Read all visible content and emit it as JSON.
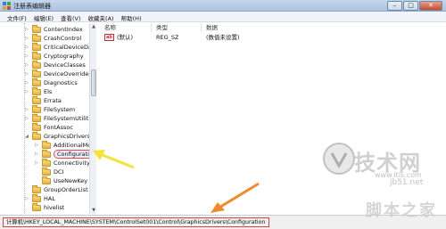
{
  "window": {
    "title": "注册表编辑器",
    "minimize_glyph": "–",
    "maximize_glyph": "□",
    "close_glyph": "✕"
  },
  "menu": [
    "文件(F)",
    "编辑(E)",
    "查看(V)",
    "收藏夹(A)",
    "帮助(H)"
  ],
  "tree": {
    "nodes": [
      {
        "label": "ContentIndex",
        "expander": "▷"
      },
      {
        "label": "CrashControl",
        "expander": "▷"
      },
      {
        "label": "CriticalDeviceDatab",
        "expander": "▷"
      },
      {
        "label": "Cryptography",
        "expander": "▷"
      },
      {
        "label": "DeviceClasses",
        "expander": "▷"
      },
      {
        "label": "DeviceOverrides",
        "expander": "▷"
      },
      {
        "label": "Diagnostics",
        "expander": "▷"
      },
      {
        "label": "Els",
        "expander": "▷"
      },
      {
        "label": "Errata",
        "expander": ""
      },
      {
        "label": "FileSystem",
        "expander": "▷"
      },
      {
        "label": "FileSystemUtilities",
        "expander": "▷"
      },
      {
        "label": "FontAssoc",
        "expander": ""
      },
      {
        "label": "GraphicsDrivers",
        "expander": "◢"
      },
      {
        "label": "AdditionalMode",
        "expander": "▷"
      },
      {
        "label": "Configuration",
        "expander": "▷"
      },
      {
        "label": "Connectivity",
        "expander": "▷"
      },
      {
        "label": "DCI",
        "expander": ""
      },
      {
        "label": "UseNewKey",
        "expander": ""
      },
      {
        "label": "GroupOrderList",
        "expander": ""
      },
      {
        "label": "HAL",
        "expander": "▷"
      },
      {
        "label": "hivelist",
        "expander": ""
      }
    ],
    "scroll_up": "▲",
    "scroll_down": "▼"
  },
  "values_pane": {
    "headers": {
      "name": "名称",
      "type": "类型",
      "data": "数据"
    },
    "rows": [
      {
        "icon": "ab",
        "name": "(默认)",
        "type": "REG_SZ",
        "data": "(数值未设置)"
      }
    ]
  },
  "status": {
    "path": "计算机\\HKEY_LOCAL_MACHINE\\SYSTEM\\ControlSet001\\Control\\GraphicsDrivers\\Configuration"
  },
  "watermark": {
    "brand": "技术网",
    "url": "www.itis.com",
    "site": "jb51.net",
    "bottom": "脚本之家"
  },
  "colors": {
    "highlight_border": "#e0484b",
    "arrow_yellow": "#f3e33a",
    "arrow_orange": "#f08a2e"
  }
}
